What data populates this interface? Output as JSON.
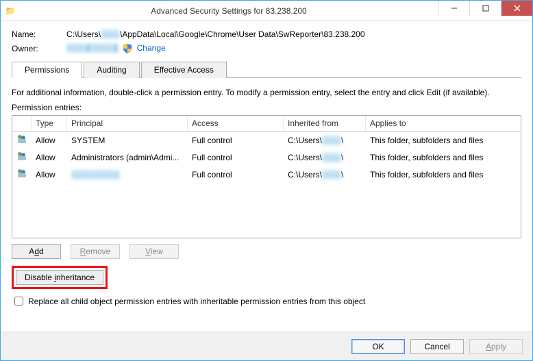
{
  "window": {
    "title": "Advanced Security Settings for 83.238.200"
  },
  "header": {
    "name_label": "Name:",
    "name_value": "C:\\Users\\······\\AppData\\Local\\Google\\Chrome\\User Data\\SwReporter\\83.238.200",
    "owner_label": "Owner:",
    "owner_value": "·······(·········)",
    "change_link": "Change"
  },
  "tabs": {
    "permissions": "Permissions",
    "auditing": "Auditing",
    "effective": "Effective Access"
  },
  "info_text": "For additional information, double-click a permission entry. To modify a permission entry, select the entry and click Edit (if available).",
  "entries_label": "Permission entries:",
  "columns": {
    "type": "Type",
    "principal": "Principal",
    "access": "Access",
    "inherited": "Inherited from",
    "applies": "Applies to"
  },
  "rows": [
    {
      "type": "Allow",
      "principal": "SYSTEM",
      "principal_blur": false,
      "access": "Full control",
      "inherited": "C:\\Users\\······\\",
      "applies": "This folder, subfolders and files"
    },
    {
      "type": "Allow",
      "principal": "Administrators (admin\\Admi...",
      "principal_blur": false,
      "access": "Full control",
      "inherited": "C:\\Users\\······\\",
      "applies": "This folder, subfolders and files"
    },
    {
      "type": "Allow",
      "principal": "······ ··········",
      "principal_blur": true,
      "access": "Full control",
      "inherited": "C:\\Users\\······\\",
      "applies": "This folder, subfolders and files"
    }
  ],
  "buttons": {
    "add": "Add",
    "remove": "Remove",
    "view": "View",
    "disable_inh": "Disable inheritance",
    "ok": "OK",
    "cancel": "Cancel",
    "apply": "Apply"
  },
  "checkbox_label": "Replace all child object permission entries with inheritable permission entries from this object"
}
